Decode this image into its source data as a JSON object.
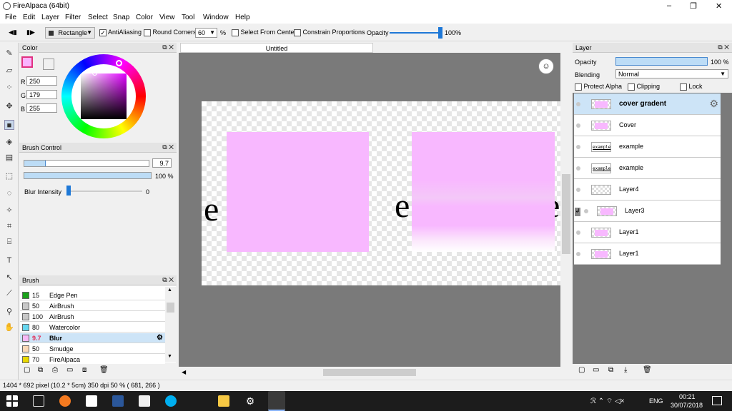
{
  "window": {
    "title": "FireAlpaca (64bit)",
    "minimize_icon": "–",
    "maximize_icon": "❐",
    "close_icon": "✕"
  },
  "menu": [
    "File",
    "Edit",
    "Layer",
    "Filter",
    "Select",
    "Snap",
    "Color",
    "View",
    "Tool",
    "Window",
    "Help"
  ],
  "toolbar": {
    "shape": "Rectangle",
    "antialiasing_label": "AntiAliasing",
    "round_corners_label": "Round Corners",
    "round_corners_value": "60",
    "percent_unit": "%",
    "select_from_center_label": "Select From Center",
    "constrain_label": "Constrain Proportions",
    "opacity_label": "Opacity",
    "opacity_value": "100%",
    "opacity_level": 1.0
  },
  "color_panel": {
    "title": "Color",
    "r_label": "R",
    "g_label": "G",
    "b_label": "B",
    "r": "250",
    "g": "179",
    "b": "255",
    "fg_color": "#fab3ff"
  },
  "brush_control": {
    "title": "Brush Control",
    "size": "9.7",
    "opacity": "100 %",
    "blur_label": "Blur Intensity",
    "blur_value": "0",
    "size_level": 0.17,
    "opacity_level": 1.0
  },
  "brush_panel": {
    "title": "Brush",
    "items": [
      {
        "size": "15",
        "name": "Edge Pen",
        "color": "#1aa31a"
      },
      {
        "size": "50",
        "name": "AirBrush",
        "color": "#c8c8c8"
      },
      {
        "size": "100",
        "name": "AirBrush",
        "color": "#c8c8c8"
      },
      {
        "size": "80",
        "name": "Watercolor",
        "color": "#68d8f0"
      },
      {
        "size": "9.7",
        "name": "Blur",
        "color": "#f7b8f7"
      },
      {
        "size": "50",
        "name": "Smudge",
        "color": "#f8d8b8"
      },
      {
        "size": "70",
        "name": "FireAlpaca",
        "color": "#e8d800"
      }
    ]
  },
  "canvas": {
    "tab": "Untitled",
    "text_char": "e"
  },
  "layer_panel": {
    "title": "Layer",
    "opacity_label": "Opacity",
    "opacity_value": "100 %",
    "blending_label": "Blending",
    "blending_value": "Normal",
    "protect_alpha": "Protect Alpha",
    "clipping": "Clipping",
    "lock": "Lock",
    "layers": [
      "cover gradent",
      "Cover",
      "example",
      "example",
      "Layer4",
      "Layer3",
      "Layer1",
      "Layer1"
    ],
    "thumb_text": "example"
  },
  "status": "1404 * 692 pixel  (10.2 * 5cm)  350 dpi  50 %  ( 681, 266 )",
  "taskbar": {
    "lang": "ENG",
    "time": "00:21",
    "date": "30/07/2018"
  }
}
